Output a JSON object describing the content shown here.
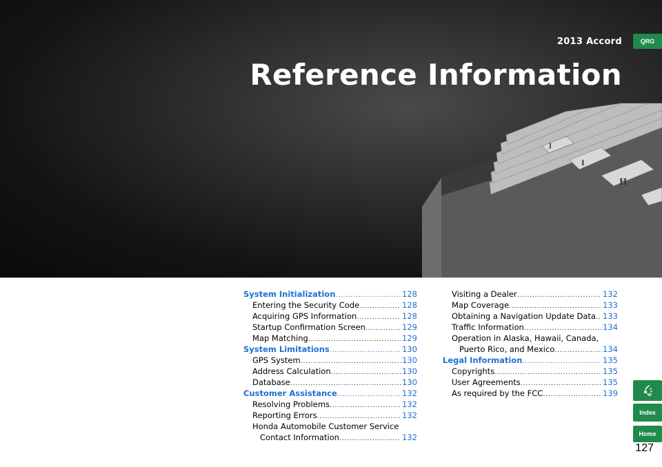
{
  "header": {
    "model": "2013 Accord",
    "title": "Reference Information"
  },
  "side_nav": {
    "qrg": "QRG",
    "index": "Index",
    "home": "Home"
  },
  "page_number": "127",
  "toc_left": [
    {
      "type": "sec",
      "label": "System Initialization",
      "page": "128"
    },
    {
      "type": "sub",
      "label": "Entering the Security Code",
      "page": "128"
    },
    {
      "type": "sub",
      "label": "Acquiring GPS Information",
      "page": "128"
    },
    {
      "type": "sub",
      "label": "Startup Confirmation Screen",
      "page": "129"
    },
    {
      "type": "sub",
      "label": "Map Matching",
      "page": "129"
    },
    {
      "type": "sec",
      "label": "System Limitations",
      "page": "130"
    },
    {
      "type": "sub",
      "label": "GPS System",
      "page": "130"
    },
    {
      "type": "sub",
      "label": "Address Calculation",
      "page": "130"
    },
    {
      "type": "sub",
      "label": "Database",
      "page": "130"
    },
    {
      "type": "sec",
      "label": "Customer Assistance",
      "page": "132"
    },
    {
      "type": "sub",
      "label": "Resolving Problems",
      "page": "132"
    },
    {
      "type": "sub",
      "label": "Reporting Errors",
      "page": "132"
    },
    {
      "type": "subnp",
      "label": "Honda Automobile Customer Service",
      "page": ""
    },
    {
      "type": "cont",
      "label": "Contact Information",
      "page": "132"
    }
  ],
  "toc_right": [
    {
      "type": "sub",
      "label": "Visiting a Dealer",
      "page": "132"
    },
    {
      "type": "sub",
      "label": "Map Coverage",
      "page": "133"
    },
    {
      "type": "sub",
      "label": "Obtaining a Navigation Update Data",
      "page": "133"
    },
    {
      "type": "sub",
      "label": "Traffic Information",
      "page": "134"
    },
    {
      "type": "subnp",
      "label": "Operation in Alaska, Hawaii, Canada,",
      "page": ""
    },
    {
      "type": "cont",
      "label": "Puerto Rico, and Mexico",
      "page": "134"
    },
    {
      "type": "sec",
      "label": "Legal Information",
      "page": "135"
    },
    {
      "type": "sub",
      "label": "Copyrights",
      "page": "135"
    },
    {
      "type": "sub",
      "label": "User Agreements",
      "page": "135"
    },
    {
      "type": "sub",
      "label": "As required by the FCC",
      "page": "139"
    }
  ]
}
